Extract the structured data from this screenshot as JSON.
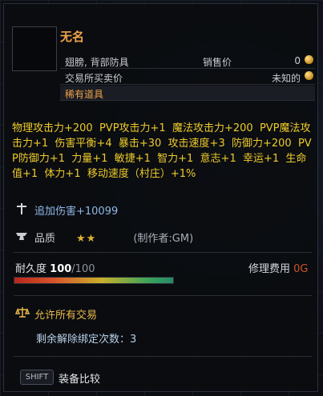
{
  "item": {
    "name": "无名",
    "slot_label": "翅膀, 背部防具",
    "sell_label": "销售价",
    "sell_value": "0",
    "trade_label": "交易所买卖价",
    "trade_value": "未知的",
    "rarity": "稀有道具"
  },
  "stats_text": "物理攻击力+200  PVP攻击力+1  魔法攻击力+200  PVP魔法攻击力+1  伤害平衡+4  暴击+30  攻击速度+3  防御力+200  PVP防御力+1  力量+1  敏捷+1  智力+1  意志+1  幸运+1  生命值+1  体力+1  移动速度（村庄）+1%",
  "added_damage": "追加伤害+10099",
  "quality": {
    "label": "品质",
    "stars": "★★",
    "maker": "(制作者:GM)",
    "star_count": 2
  },
  "durability": {
    "label": "耐久度",
    "current": "100",
    "max": "/100",
    "fraction": 1.0
  },
  "repair": {
    "label": "修理费用",
    "cost": "0G"
  },
  "trade_allowed": "允许所有交易",
  "unbind_remaining": "剩余解除绑定次数：3",
  "shift_key": "SHIFT",
  "compare_label": "装备比较",
  "icons": {
    "sell_coin": "gold-coin-icon",
    "trade_coin": "gold-coin-icon",
    "added_damage": "sword-icon",
    "quality": "anvil-icon",
    "trade": "scales-icon"
  },
  "colors": {
    "name": "#f0a24a",
    "stats": "#eecb2a",
    "added_damage": "#8fb8e6",
    "trade": "#e9b84a",
    "repair_cost": "#d0502e"
  }
}
